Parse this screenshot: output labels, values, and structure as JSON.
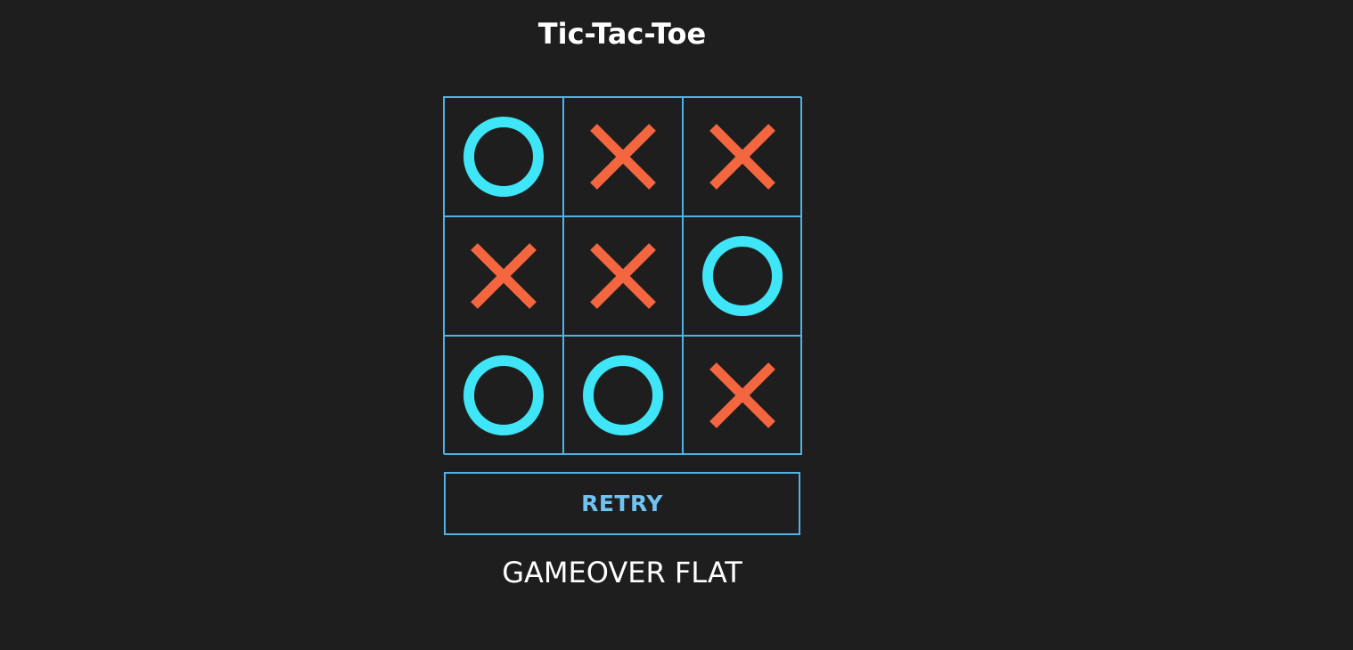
{
  "title": "Tic-Tac-Toe",
  "colors": {
    "background": "#1e1e1e",
    "grid": "#4fb3e8",
    "o": "#3ee6f7",
    "x": "#f4663f",
    "retry_text": "#6ec3f2",
    "text": "#ffffff"
  },
  "board": [
    [
      "O",
      "X",
      "X"
    ],
    [
      "X",
      "X",
      "O"
    ],
    [
      "O",
      "O",
      "X"
    ]
  ],
  "retry_label": "RETRY",
  "status": "GAMEOVER FLAT"
}
